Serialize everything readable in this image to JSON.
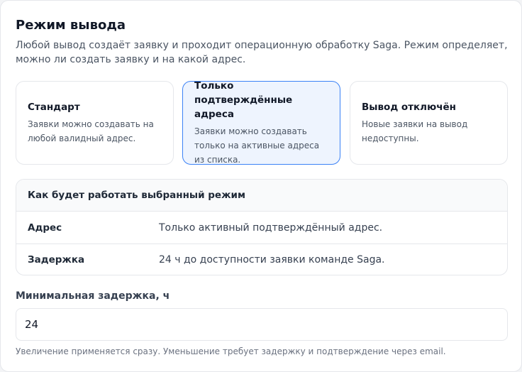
{
  "header": {
    "title": "Режим вывода",
    "description": "Любой вывод создаёт заявку и проходит операционную обработку Saga. Режим определяет, можно ли создать заявку и на какой адрес."
  },
  "modes": [
    {
      "title": "Стандарт",
      "text": "Заявки можно создавать на любой валидный адрес.",
      "selected": false
    },
    {
      "title": "Только подтверждённые адреса",
      "text": "Заявки можно создавать только на активные адреса из списка.",
      "selected": true
    },
    {
      "title": "Вывод отключён",
      "text": "Новые заявки на вывод недоступны.",
      "selected": false
    }
  ],
  "summary": {
    "heading": "Как будет работать выбранный режим",
    "rows": [
      {
        "key": "Адрес",
        "value": "Только активный подтверждённый адрес."
      },
      {
        "key": "Задержка",
        "value": "24 ч до доступности заявки команде Saga."
      }
    ]
  },
  "delay_field": {
    "label": "Минимальная задержка, ч",
    "value": "24"
  },
  "hint": "Увеличение применяется сразу. Уменьшение требует задержку и подтверждение через email.",
  "colors": {
    "accent": "#3b82f6",
    "selected_bg": "#eef4fe",
    "border": "#e5e7eb"
  }
}
